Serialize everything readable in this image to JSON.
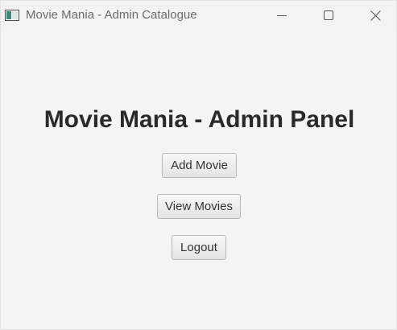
{
  "window": {
    "title": "Movie Mania - Admin Catalogue",
    "controls": {
      "minimize_icon": "minimize-icon",
      "maximize_icon": "maximize-icon",
      "close_icon": "close-icon"
    }
  },
  "main": {
    "heading": "Movie Mania - Admin Panel",
    "buttons": {
      "add_movie": "Add Movie",
      "view_movies": "View Movies",
      "logout": "Logout"
    }
  },
  "colors": {
    "background": "#f4f4f4",
    "heading_text": "#2a2a2a",
    "button_border": "#b9b9b9",
    "title_text": "#6b6b6b"
  }
}
